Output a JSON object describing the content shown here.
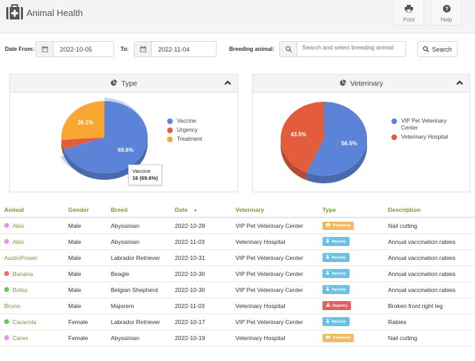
{
  "header": {
    "title": "Animal Health",
    "app_icon": "medkit-icon",
    "print_label": "Print",
    "help_label": "Help"
  },
  "filters": {
    "date_from_label": "Date From:",
    "date_from_value": "2022-10-05",
    "date_to_label": "To:",
    "date_to_value": "2022-11-04",
    "breeding_label": "Breeding animal:",
    "breeding_placeholder": "Search and select breeding animal",
    "breeding_value": "",
    "search_label": "Search"
  },
  "panels": {
    "type_title": "Type",
    "vet_title": "Veterinary",
    "tooltip_label": "Vaccine",
    "tooltip_value": "16 (69.6%)"
  },
  "chart_data": [
    {
      "type": "pie",
      "title": "Type",
      "categories": [
        "Vaccine",
        "Urgency",
        "Treatment"
      ],
      "values": [
        69.6,
        4.3,
        26.1
      ],
      "labels": [
        "69.6%",
        "",
        "26.1%"
      ],
      "colors": [
        "#5b84d8",
        "#e35d3c",
        "#f8a732"
      ],
      "legend": "right",
      "highlighted": "Vaccine",
      "tooltip": "Vaccine 16 (69.6%)"
    },
    {
      "type": "pie",
      "title": "Veterinary",
      "categories": [
        "VIP Pet Veterinary Center",
        "Veterinary Hospital"
      ],
      "values": [
        56.5,
        43.5
      ],
      "labels": [
        "56.5%",
        "43.5%"
      ],
      "colors": [
        "#5b84d8",
        "#e35d3c"
      ],
      "legend": "right"
    }
  ],
  "table": {
    "columns": [
      "Animal",
      "Gender",
      "Breed",
      "Date",
      "Veterinary",
      "Type",
      "Description"
    ],
    "sort_column": "Date",
    "rows": [
      {
        "animal": "Abis",
        "dot": "#d99ae6",
        "gender": "Male",
        "breed": "Abyssinian",
        "date": "2022-10-28",
        "vet": "VIP Pet Veterinary Center",
        "type": "Treatment",
        "desc": "Nail cutting"
      },
      {
        "animal": "Abis",
        "dot": "#d99ae6",
        "gender": "Male",
        "breed": "Abyssinian",
        "date": "2022-11-03",
        "vet": "Veterinary Hospital",
        "type": "Vaccine",
        "desc": "Annual vaccination rabies"
      },
      {
        "animal": "AustinPower",
        "dot": "",
        "gender": "Male",
        "breed": "Labrador Retriever",
        "date": "2022-10-31",
        "vet": "VIP Pet Veterinary Center",
        "type": "Vaccine",
        "desc": "Annual vaccination rabies"
      },
      {
        "animal": "Banana",
        "dot": "#f06b6b",
        "gender": "Male",
        "breed": "Beagle",
        "date": "2022-10-30",
        "vet": "VIP Pet Veterinary Center",
        "type": "Vaccine",
        "desc": "Annual vaccination rabies"
      },
      {
        "animal": "Botas",
        "dot": "#6cc45a",
        "gender": "Male",
        "breed": "Belgian Shepherd",
        "date": "2022-10-30",
        "vet": "VIP Pet Veterinary Center",
        "type": "Vaccine",
        "desc": "Annual vaccination rabies"
      },
      {
        "animal": "Bruno",
        "dot": "",
        "gender": "Male",
        "breed": "Majorero",
        "date": "2022-11-03",
        "vet": "Veterinary Hospital",
        "type": "Urgency",
        "desc": "Broken front right leg"
      },
      {
        "animal": "Caracola",
        "dot": "#6cc45a",
        "gender": "Female",
        "breed": "Labrador Retriever",
        "date": "2022-10-17",
        "vet": "VIP Pet Veterinary Center",
        "type": "Vaccine",
        "desc": "Rabies"
      },
      {
        "animal": "Carex",
        "dot": "#d99ae6",
        "gender": "Female",
        "breed": "Abyssinian",
        "date": "2022-10-19",
        "vet": "Veterinary Hospital",
        "type": "Treatment",
        "desc": "Nail cutting"
      }
    ]
  },
  "badge_colors": {
    "Treatment": "#f2b95e",
    "Vaccine": "#6ac3e6",
    "Urgency": "#e06161"
  }
}
